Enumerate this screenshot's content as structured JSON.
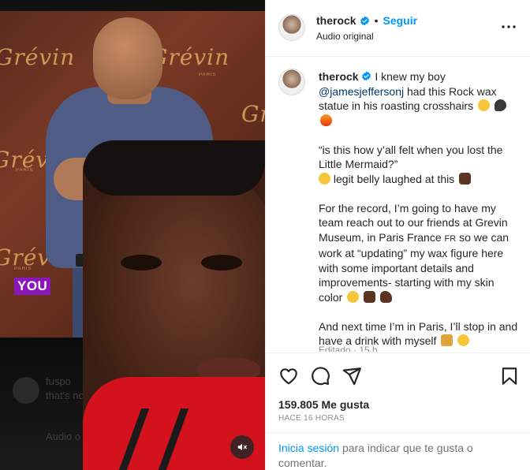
{
  "post": {
    "username": "therock",
    "follow_label": "Seguir",
    "separator": "•",
    "audio": "Audio original",
    "media_badge": "YOU",
    "grevin_text": "Grévin",
    "grevin_sub": "PARIS",
    "ghost_lines": [
      "fuspo",
      "that's no",
      "Audio o"
    ]
  },
  "caption": {
    "username": "therock",
    "lines": {
      "intro": "I knew my boy",
      "mention": "@jamesjeffersonj",
      "intro_rest": "had this Rock wax statue in his roasting crosshairs",
      "quote": "“is this how y’all felt when you lost the Little Mermaid?”",
      "laugh": "legit belly laughed at this",
      "record": "For the record, I’m going to have my team reach out to our friends at Grevin Museum, in Paris France",
      "flag": "FR",
      "record_rest": "so we can work at “updating” my wax figure here with some important details and improvements- starting with my skin color",
      "next": "And next time I’m in Paris, I’ll stop in and have a drink with myself"
    },
    "meta": "Editado · 15 h"
  },
  "actions": {
    "likes": "159.805 Me gusta",
    "time_ago": "HACE 16 HORAS",
    "login_link": "Inicia sesión",
    "login_rest": "para indicar que te gusta o comentar."
  },
  "colors": {
    "accent": "#0095f6",
    "verified": "#0095f6",
    "badge": "#8b17b8",
    "hoodie": "#d3121d"
  }
}
